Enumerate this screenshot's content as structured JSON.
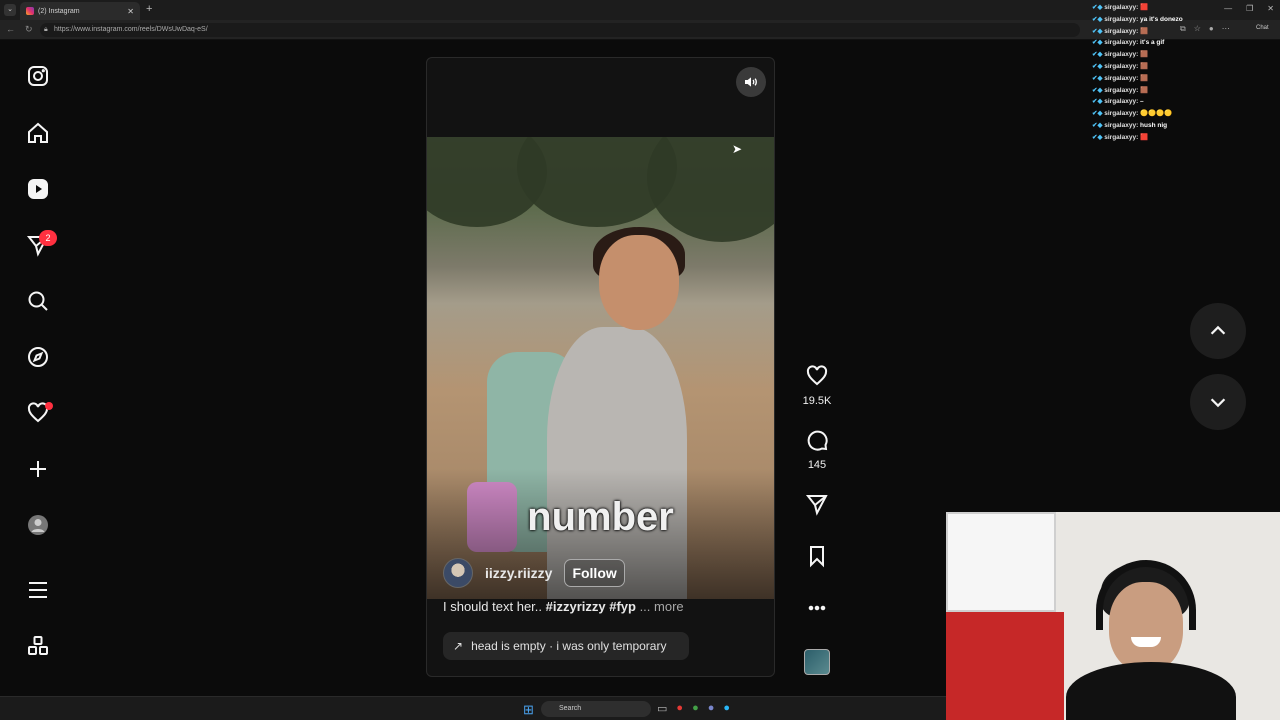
{
  "browser": {
    "tab_title": "(2) Instagram",
    "new_tab": "+",
    "url": "https://www.instagram.com/reels/DWsUwDaq-eS/",
    "chat_button": "Chat"
  },
  "stream_chat": [
    {
      "user": "sirgalaxyy:",
      "msg": "🟥"
    },
    {
      "user": "sirgalaxyy:",
      "msg": "ya it's donezo"
    },
    {
      "user": "sirgalaxyy:",
      "msg": "🟫"
    },
    {
      "user": "sirgalaxyy:",
      "msg": "it's a gif"
    },
    {
      "user": "sirgalaxyy:",
      "msg": "🟫"
    },
    {
      "user": "sirgalaxyy:",
      "msg": "🟫"
    },
    {
      "user": "sirgalaxyy:",
      "msg": "🟫"
    },
    {
      "user": "sirgalaxyy:",
      "msg": "🟫"
    },
    {
      "user": "sirgalaxyy:",
      "msg": "–"
    },
    {
      "user": "sirgalaxyy:",
      "msg": "🟡🟡🟡🟡"
    },
    {
      "user": "sirgalaxyy:",
      "msg": "hush nig"
    },
    {
      "user": "sirgalaxyy:",
      "msg": "🟥"
    }
  ],
  "sidebar": {
    "messages_badge": "2",
    "icons": [
      "instagram-logo-icon",
      "home-icon",
      "reels-icon",
      "messages-icon",
      "search-icon",
      "explore-icon",
      "notifications-icon",
      "create-icon",
      "profile-icon",
      "menu-icon",
      "apps-icon"
    ]
  },
  "reel": {
    "caption_overlay": "number",
    "username": "iizzy.riizzy",
    "follow_label": "Follow",
    "description_text": "I should text her.. ",
    "description_tags": "#izzyrizzy #fyp",
    "description_more": " ... more",
    "audio": "head is empty · i was only temporary",
    "likes": "19.5K",
    "comments": "145"
  },
  "taskbar": {
    "search_label": "Search"
  }
}
